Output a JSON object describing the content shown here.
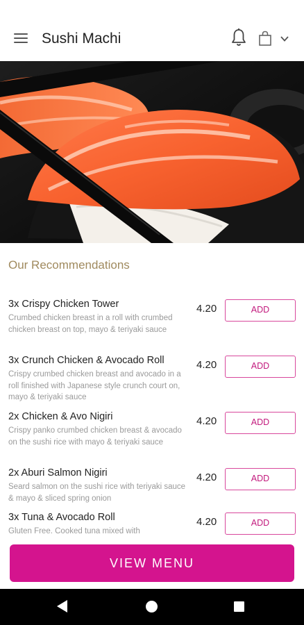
{
  "header": {
    "title": "Sushi Machi",
    "icons": [
      "menu-icon",
      "bell-icon",
      "shopping-bag-icon",
      "chevron-down-icon"
    ]
  },
  "hero": {
    "image": "salmon-nigiri-photo"
  },
  "recommendations": {
    "title": "Our Recommendations",
    "items": [
      {
        "name": "3x Crispy Chicken Tower",
        "description": "Crumbed chicken breast in a roll with crumbed chicken breast on top, mayo & teriyaki sauce",
        "price": "4.20",
        "add_label": "ADD"
      },
      {
        "name": "3x Crunch Chicken & Avocado Roll",
        "description": "Crispy crumbed chicken breast and avocado in a roll finished with Japanese style crunch court on, mayo & teriyaki sauce",
        "price": "4.20",
        "add_label": "ADD"
      },
      {
        "name": "2x Chicken & Avo Nigiri",
        "description": "Crispy panko crumbed chicken breast & avocado on the sushi rice with mayo & teriyaki sauce",
        "price": "4.20",
        "add_label": "ADD"
      },
      {
        "name": "2x Aburi Salmon Nigiri",
        "description": "Seard salmon on the sushi rice with teriyaki sauce & mayo & sliced spring onion",
        "price": "4.20",
        "add_label": "ADD"
      },
      {
        "name": "3x Tuna & Avocado Roll",
        "description": "Gluten Free. Cooked tuna mixed with",
        "price": "4.20",
        "add_label": "ADD"
      }
    ]
  },
  "view_menu_label": "VIEW MENU",
  "colors": {
    "accent": "#d4148e",
    "section_title": "#a08a5e",
    "add_border": "#d8479c"
  },
  "system_nav": {
    "icons": [
      "back-icon",
      "home-icon",
      "recents-icon"
    ]
  }
}
